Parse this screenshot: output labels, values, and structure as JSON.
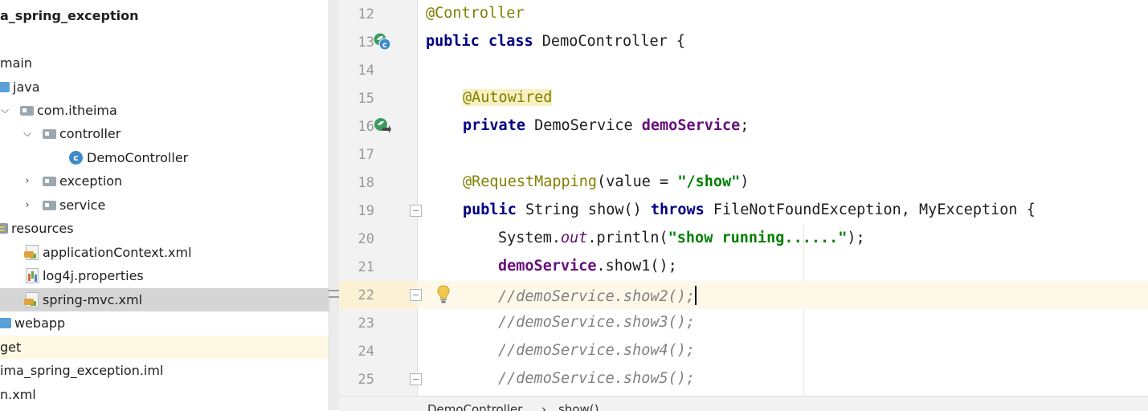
{
  "project_tree": {
    "items": [
      {
        "label": "a_spring_exception",
        "bold": true
      },
      {
        "label": ""
      },
      {
        "label": "main"
      },
      {
        "label": "java"
      },
      {
        "label": "com.itheima"
      },
      {
        "label": "controller"
      },
      {
        "label": "DemoController"
      },
      {
        "label": "exception"
      },
      {
        "label": "service"
      },
      {
        "label": "resources"
      },
      {
        "label": "applicationContext.xml"
      },
      {
        "label": "log4j.properties"
      },
      {
        "label": "spring-mvc.xml"
      },
      {
        "label": "webapp"
      },
      {
        "label": "get"
      },
      {
        "label": "ima_spring_exception.iml"
      },
      {
        "label": "n.xml"
      }
    ]
  },
  "editor": {
    "lines": [
      {
        "number": "12",
        "text": "@Controller"
      },
      {
        "number": "13",
        "keyword": "public class",
        "text": " DemoController {"
      },
      {
        "number": "14",
        "text": ""
      },
      {
        "number": "15",
        "text": "@Autowired"
      },
      {
        "number": "16",
        "keyword": "private",
        "type": " DemoService ",
        "field": "demoService",
        "rest": ";"
      },
      {
        "number": "17",
        "text": ""
      },
      {
        "number": "18",
        "annotation": "@RequestMapping",
        "paren": "(value = ",
        "string": "\"/show\"",
        "end": ")"
      },
      {
        "number": "19",
        "kw1": "public",
        "mid": " String show() ",
        "kw2": "throws",
        "rest": " FileNotFoundException, MyException {"
      },
      {
        "number": "20",
        "prefix": "System.",
        "static_field": "out",
        "mid": ".println(",
        "string": "\"show running......\"",
        "end": ");"
      },
      {
        "number": "21",
        "field": "demoService",
        "rest": ".show1();"
      },
      {
        "number": "22",
        "comment": "//demoService.show2();"
      },
      {
        "number": "23",
        "comment": "//demoService.show3();"
      },
      {
        "number": "24",
        "comment": "//demoService.show4();"
      },
      {
        "number": "25",
        "comment": "//demoService.show5();"
      }
    ]
  },
  "breadcrumb": {
    "items": [
      "DemoController",
      "show()"
    ],
    "separator": "›"
  },
  "icons": {
    "class_icon_letter": "c",
    "bean_icon_color": "#3c9a5f"
  }
}
